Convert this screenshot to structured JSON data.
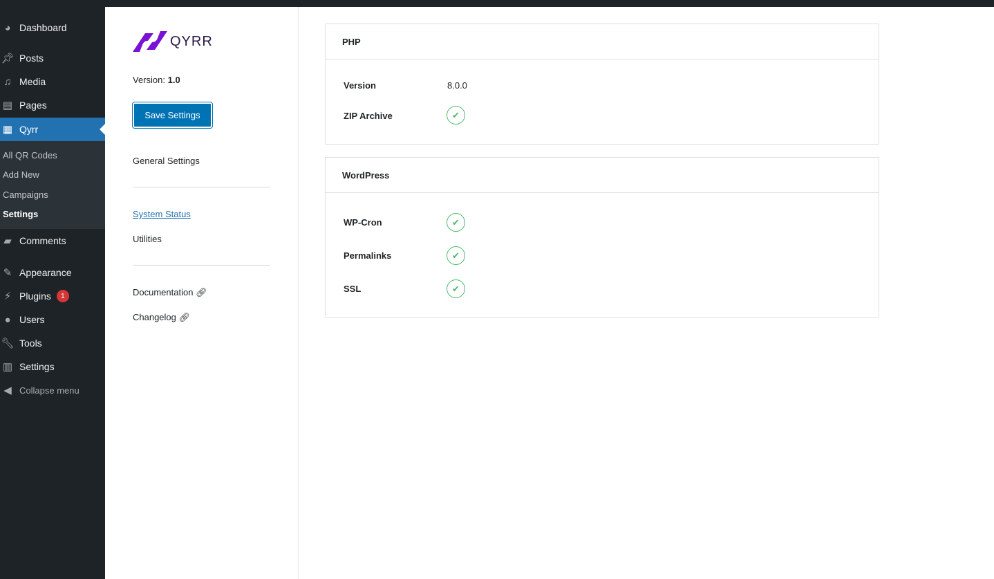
{
  "menu": {
    "items": [
      {
        "label": "Dashboard",
        "icon": "dashboard-icon"
      },
      {
        "label": "Posts",
        "icon": "pin-icon"
      },
      {
        "label": "Media",
        "icon": "media-icon"
      },
      {
        "label": "Pages",
        "icon": "pages-icon"
      },
      {
        "label": "Qyrr",
        "icon": "qr-icon"
      },
      {
        "label": "Comments",
        "icon": "comment-icon"
      },
      {
        "label": "Appearance",
        "icon": "brush-icon"
      },
      {
        "label": "Plugins",
        "icon": "plugin-icon",
        "badge": "1"
      },
      {
        "label": "Users",
        "icon": "user-icon"
      },
      {
        "label": "Tools",
        "icon": "wrench-icon"
      },
      {
        "label": "Settings",
        "icon": "sliders-icon"
      }
    ],
    "submenu": [
      "All QR Codes",
      "Add New",
      "Campaigns",
      "Settings"
    ],
    "collapse": "Collapse menu"
  },
  "panel": {
    "logo": "QYRR",
    "version_label": "Version:",
    "version": "1.0",
    "save": "Save Settings",
    "general": "General Settings",
    "system_status": "System Status",
    "utilities": "Utilities",
    "documentation": "Documentation",
    "changelog": "Changelog"
  },
  "php": {
    "title": "PHP",
    "version_label": "Version",
    "version": "8.0.0",
    "zip_label": "ZIP Archive"
  },
  "wordpress": {
    "title": "WordPress",
    "cron": "WP-Cron",
    "permalinks": "Permalinks",
    "ssl": "SSL"
  },
  "colors": {
    "accent": "#2271b1",
    "success": "#4ab866",
    "brand": "#7a12d4"
  }
}
